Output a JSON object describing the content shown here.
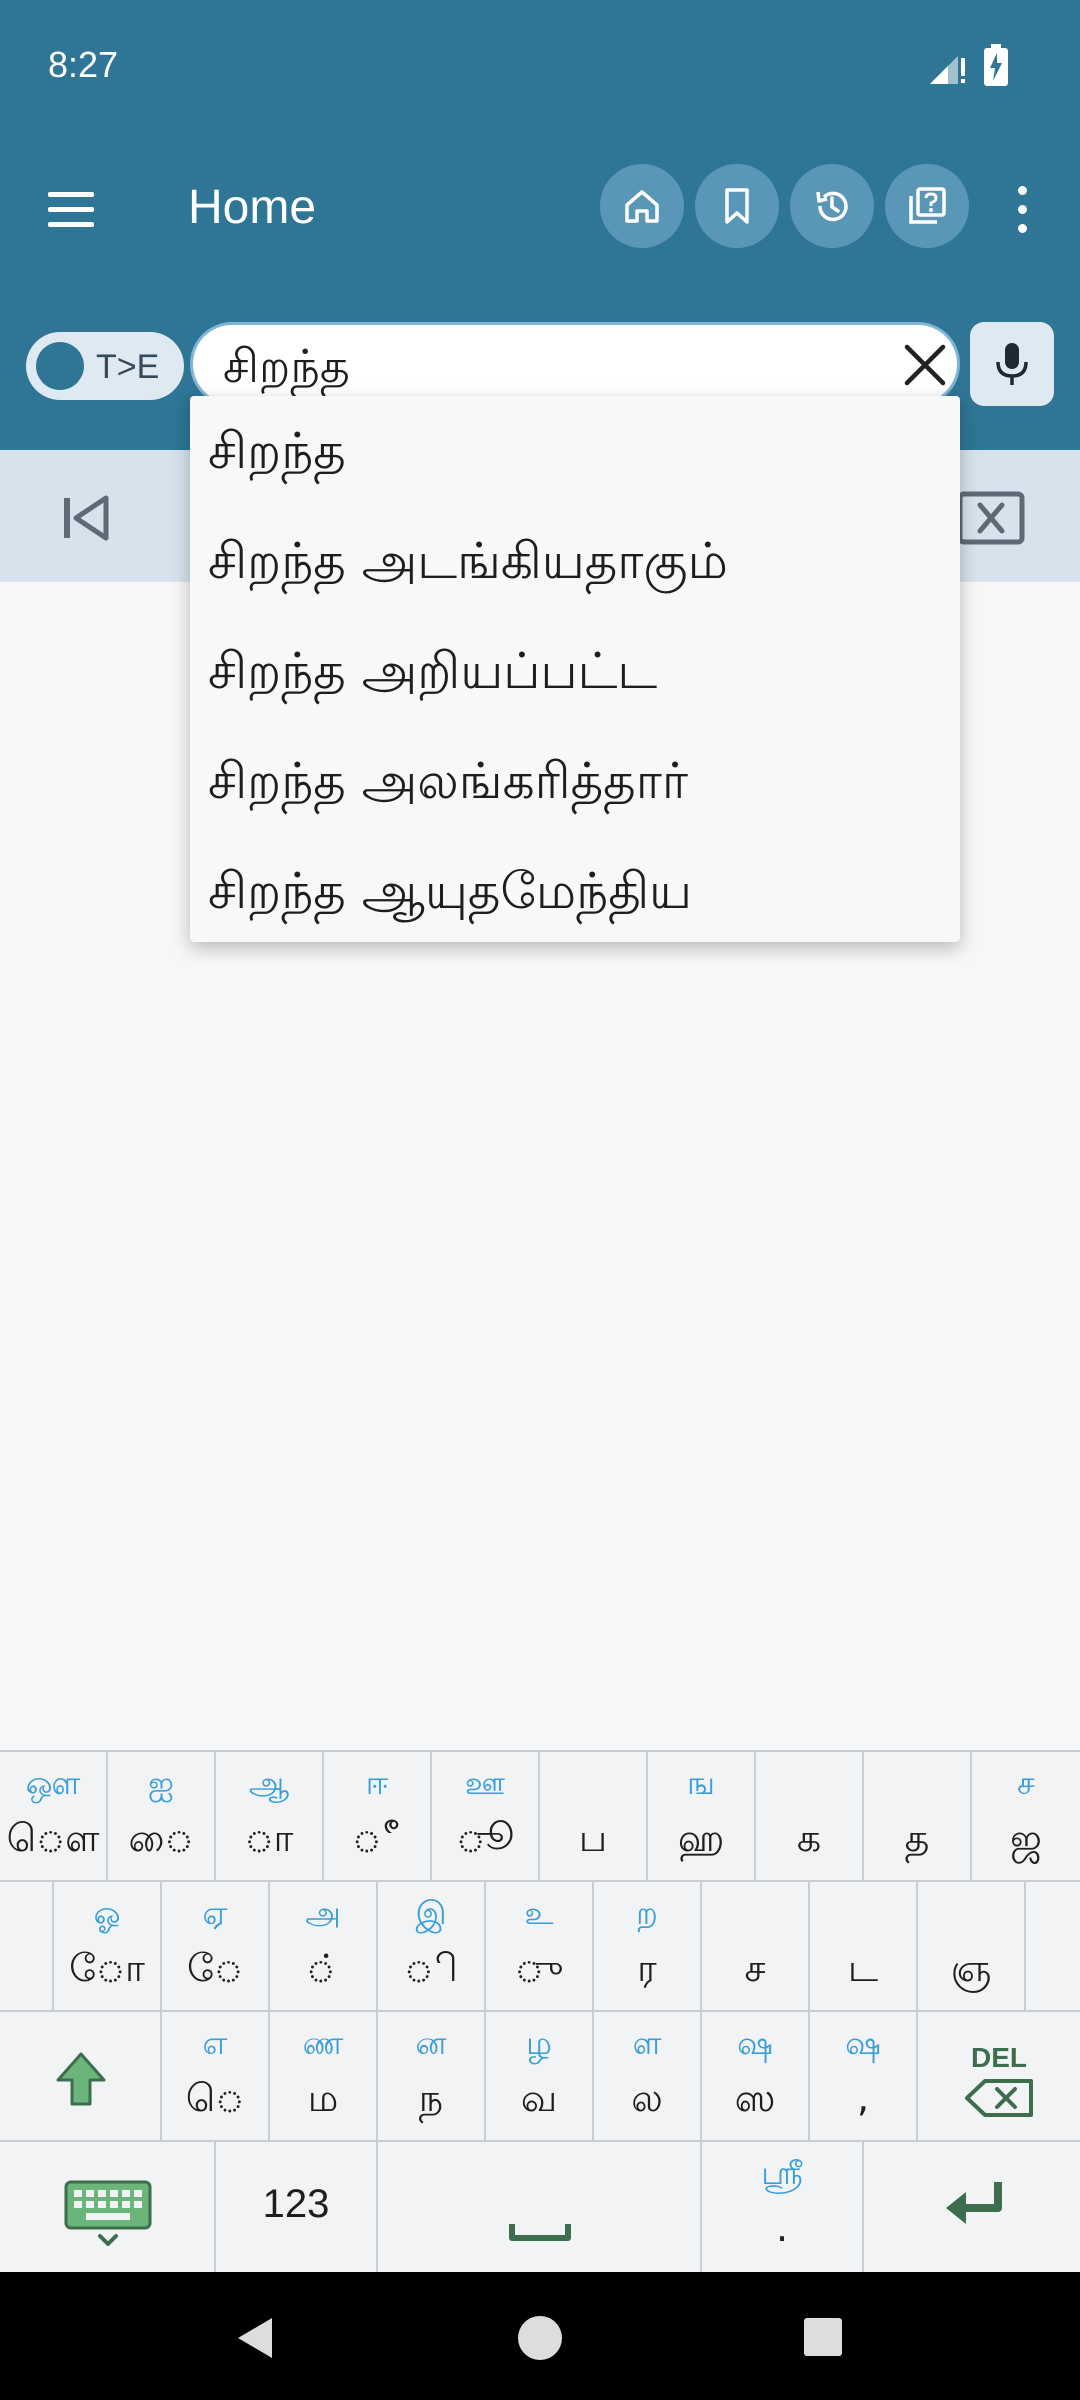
{
  "status": {
    "time": "8:27"
  },
  "appbar": {
    "title": "Home",
    "buttons": [
      "home-icon",
      "bookmark-icon",
      "history-icon",
      "quiz-icon"
    ]
  },
  "search": {
    "toggle_label": "T>E",
    "value": "சிறந்த"
  },
  "suggestions": [
    "சிறந்த",
    "சிறந்த அடங்கியதாகும்",
    "சிறந்த அறியப்பட்ட",
    "சிறந்த அலங்கரித்தார்",
    "சிறந்த ஆயுதமேந்திய"
  ],
  "keyboard": {
    "row1": [
      {
        "alt": "ஔ",
        "main": "ௌ"
      },
      {
        "alt": "ஐ",
        "main": "ை"
      },
      {
        "alt": "ஆ",
        "main": "ா"
      },
      {
        "alt": "ஈ",
        "main": "ீ"
      },
      {
        "alt": "ஊ",
        "main": "ூ"
      },
      {
        "alt": "",
        "main": "ப"
      },
      {
        "alt": "ங",
        "main": "ஹ"
      },
      {
        "alt": "",
        "main": "க"
      },
      {
        "alt": "",
        "main": "த"
      },
      {
        "alt": "ச",
        "main": "ஜ"
      }
    ],
    "row2": [
      {
        "alt": "ஓ",
        "main": "ோ"
      },
      {
        "alt": "ஏ",
        "main": "ே"
      },
      {
        "alt": "அ",
        "main": "்"
      },
      {
        "alt": "இ",
        "main": "ி"
      },
      {
        "alt": "உ",
        "main": "ு"
      },
      {
        "alt": "ற",
        "main": "ர"
      },
      {
        "alt": "",
        "main": "ச"
      },
      {
        "alt": "",
        "main": "ட"
      },
      {
        "alt": "",
        "main": "ஞ"
      }
    ],
    "row3": [
      {
        "alt": "எ",
        "main": "ெ"
      },
      {
        "alt": "ண",
        "main": "ம"
      },
      {
        "alt": "ன",
        "main": "ந"
      },
      {
        "alt": "ழ",
        "main": "வ"
      },
      {
        "alt": "ள",
        "main": "ல"
      },
      {
        "alt": "ஷ",
        "main": "ஸ"
      },
      {
        "alt": "ஷ",
        "main": ","
      }
    ],
    "del_label": "DEL",
    "numbers_label": "123",
    "shri_alt": "ஸ்ரீ",
    "shri_main": "."
  },
  "colors": {
    "primary": "#2f7595",
    "accent": "#3a9ed8",
    "key_icon": "#3c6e4e"
  }
}
